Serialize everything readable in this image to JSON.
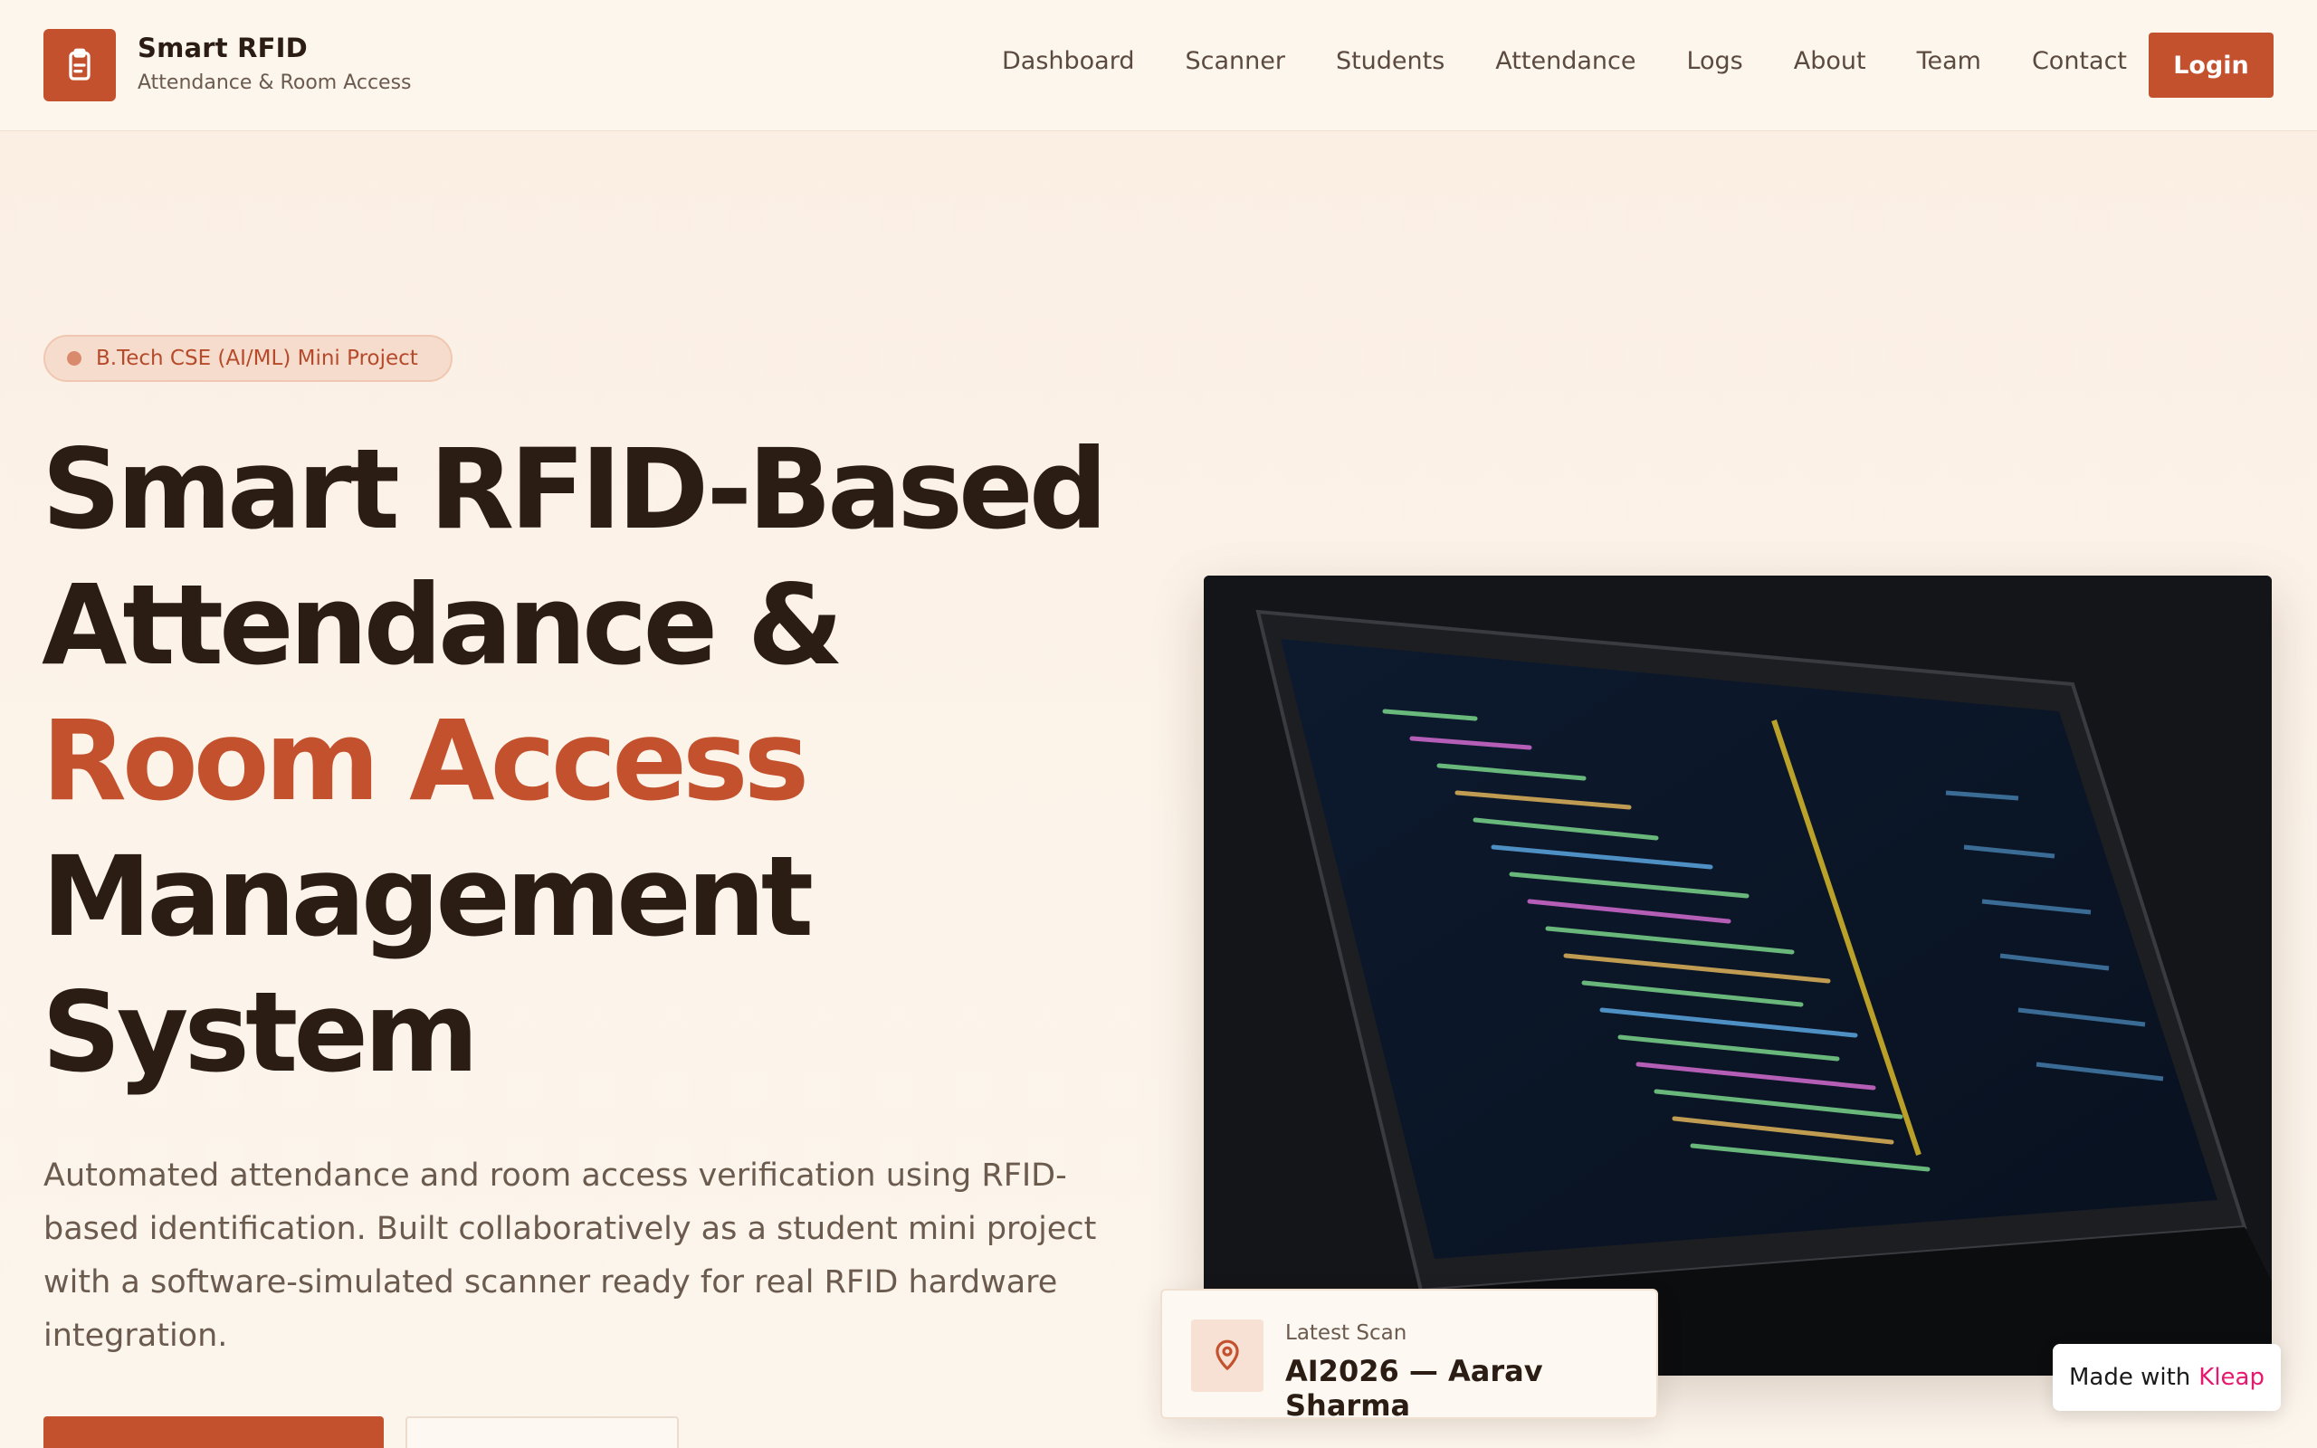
{
  "header": {
    "brand_title": "Smart RFID",
    "brand_subtitle": "Attendance & Room Access",
    "nav": [
      "Dashboard",
      "Scanner",
      "Students",
      "Attendance",
      "Logs",
      "About",
      "Team",
      "Contact"
    ],
    "login_label": "Login"
  },
  "hero": {
    "badge": "B.Tech CSE (AI/ML) Mini Project",
    "headline_part1": "Smart RFID-Based Attendance & ",
    "headline_accent": "Room Access",
    "headline_part2": " Management System",
    "lead": "Automated attendance and room access verification using RFID-based identification. Built collaboratively as a student mini project with a software-simulated scanner ready for real RFID hardware integration."
  },
  "scan_card": {
    "label": "Latest Scan",
    "value": "AI2026 — Aarav Sharma"
  },
  "made_with": {
    "prefix": "Made with",
    "brand": "Kleap"
  },
  "colors": {
    "accent": "#c4512e",
    "text": "#2b1d14",
    "muted": "#6b5a4e"
  },
  "icons": [
    "clipboard-icon",
    "map-pin-icon"
  ]
}
